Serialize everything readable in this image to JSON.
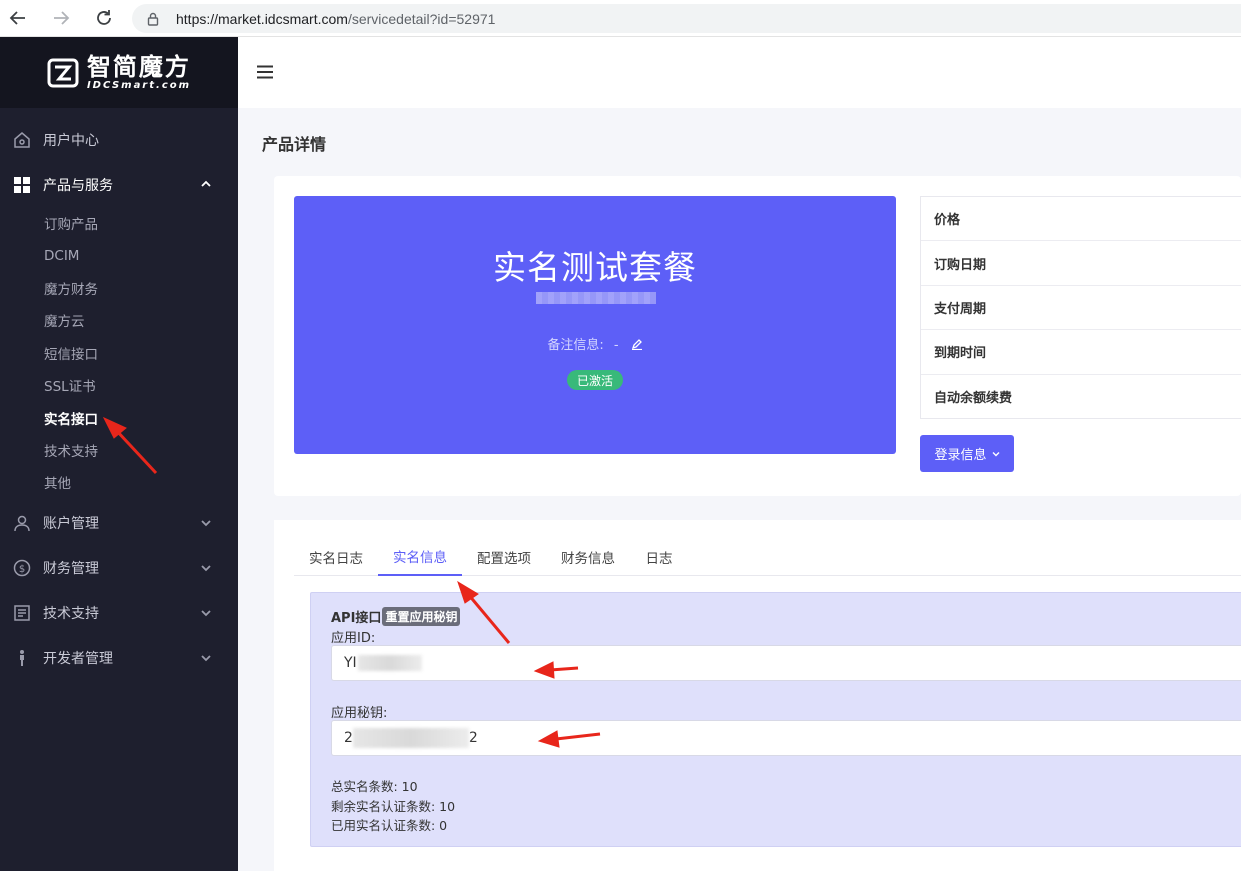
{
  "browser": {
    "url_host": "https://market.idcsmart.com",
    "url_path": "/servicedetail?id=52971"
  },
  "brand": {
    "name_cn": "智简魔方",
    "name_en": "IDCSmart.com"
  },
  "sidebar": {
    "menu": [
      {
        "label": "用户中心",
        "icon": "home-icon"
      },
      {
        "label": "产品与服务",
        "icon": "grid-icon",
        "expanded": true,
        "children": [
          "订购产品",
          "DCIM",
          "魔方财务",
          "魔方云",
          "短信接口",
          "SSL证书",
          "实名接口",
          "技术支持",
          "其他"
        ],
        "current_child": "实名接口"
      },
      {
        "label": "账户管理",
        "icon": "user-icon"
      },
      {
        "label": "财务管理",
        "icon": "dollar-icon"
      },
      {
        "label": "技术支持",
        "icon": "ticket-icon"
      },
      {
        "label": "开发者管理",
        "icon": "developer-icon"
      }
    ]
  },
  "page": {
    "title": "产品详情"
  },
  "product": {
    "name": "实名测试套餐",
    "remark_label": "备注信息:",
    "remark_value": "-",
    "status": "已激活"
  },
  "info_table": [
    "价格",
    "订购日期",
    "支付周期",
    "到期时间",
    "自动余额续费"
  ],
  "login_button": "登录信息",
  "tabs": [
    "实名日志",
    "实名信息",
    "配置选项",
    "财务信息",
    "日志"
  ],
  "active_tab": "实名信息",
  "api": {
    "title": "API接口",
    "reset_label": "重置应用秘钥",
    "app_id_label": "应用ID:",
    "app_id_prefix": "YI",
    "app_secret_label": "应用秘钥:",
    "app_secret_prefix": "2",
    "app_secret_suffix": "2",
    "stat_total": "总实名条数: 10",
    "stat_remaining": "剩余实名认证条数: 10",
    "stat_used": "已用实名认证条数: 0"
  },
  "colors": {
    "primary": "#5d5ff7",
    "sidebar_bg": "#1e1f2e",
    "success": "#38b97a",
    "annotation": "#e8261b"
  }
}
